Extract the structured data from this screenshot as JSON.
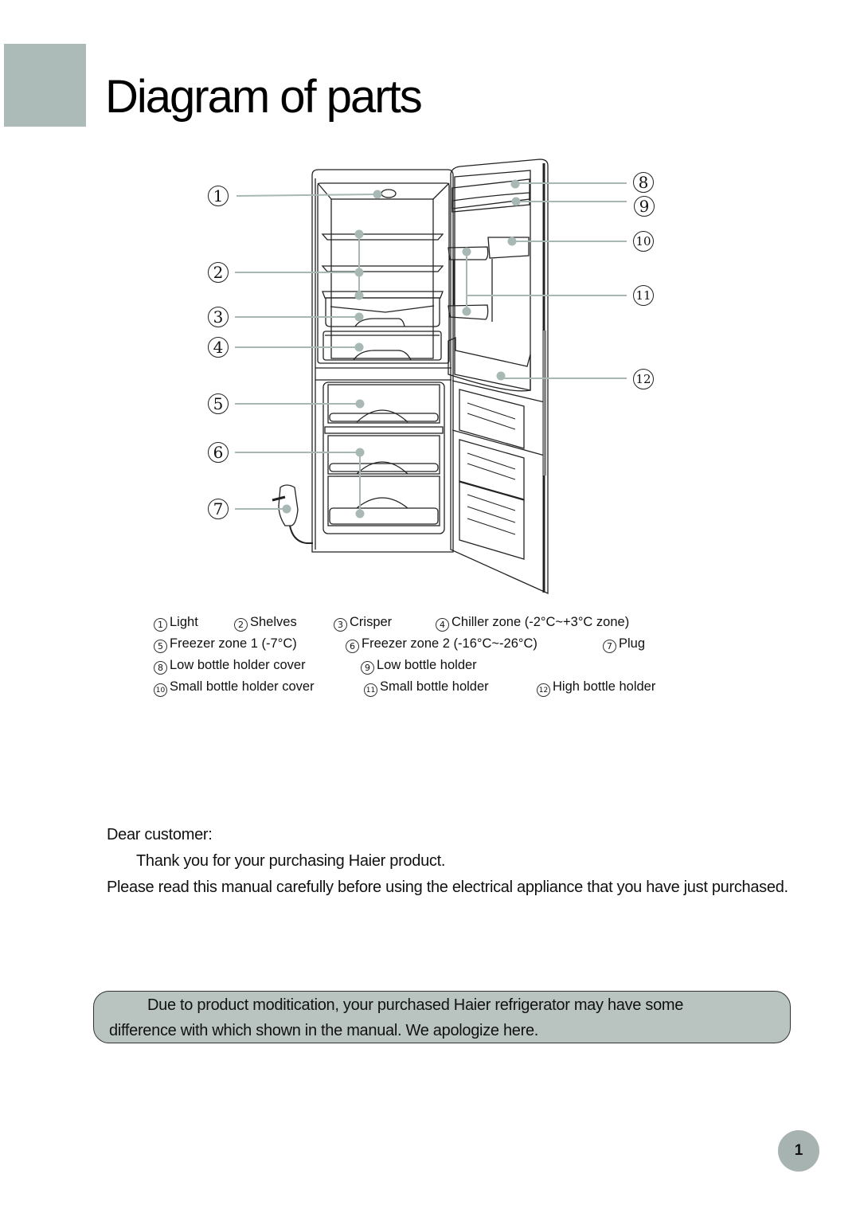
{
  "header": {
    "title": "Diagram of parts"
  },
  "colors": {
    "accent_gray": "#adbbb8",
    "marker": "#a8b8b5",
    "notice_bg": "#b9c4c1"
  },
  "diagram": {
    "callouts": [
      {
        "num": "1",
        "part": "Light"
      },
      {
        "num": "2",
        "part": "Shelves"
      },
      {
        "num": "3",
        "part": "Crisper"
      },
      {
        "num": "4",
        "part": "Chiller zone"
      },
      {
        "num": "5",
        "part": "Freezer zone 1"
      },
      {
        "num": "6",
        "part": "Freezer zone 2"
      },
      {
        "num": "7",
        "part": "Plug"
      },
      {
        "num": "8",
        "part": "Low bottle holder cover"
      },
      {
        "num": "9",
        "part": "Low bottle holder"
      },
      {
        "num": "10",
        "part": "Small bottle holder cover"
      },
      {
        "num": "11",
        "part": "Small bottle holder"
      },
      {
        "num": "12",
        "part": "High bottle holder"
      }
    ]
  },
  "legend": {
    "items": [
      {
        "num": "1",
        "label": "Light"
      },
      {
        "num": "2",
        "label": "Shelves"
      },
      {
        "num": "3",
        "label": "Crisper"
      },
      {
        "num": "4",
        "label": "Chiller zone  (-2°C~+3°C zone)"
      },
      {
        "num": "5",
        "label": "Freezer zone 1 (-7°C)"
      },
      {
        "num": "6",
        "label": "Freezer zone 2 (-16°C~-26°C)"
      },
      {
        "num": "7",
        "label": "Plug"
      },
      {
        "num": "8",
        "label": "Low bottle holder  cover"
      },
      {
        "num": "9",
        "label": "Low bottle holder"
      },
      {
        "num": "10",
        "label": "Small bottle holder cover"
      },
      {
        "num": "11",
        "label": "Small bottle holder"
      },
      {
        "num": "12",
        "label": "High bottle holder"
      }
    ]
  },
  "intro": {
    "salutation": "Dear customer:",
    "thanks": "Thank you for your purchasing Haier product.",
    "instruction": "Please read this manual carefully before using the electrical appliance that you have just purchased."
  },
  "notice": {
    "line1": "Due to product moditication, your purchased Haier refrigerator may have some",
    "line2": "difference with which shown in the manual. We apologize here."
  },
  "footer": {
    "page_number": "1"
  }
}
